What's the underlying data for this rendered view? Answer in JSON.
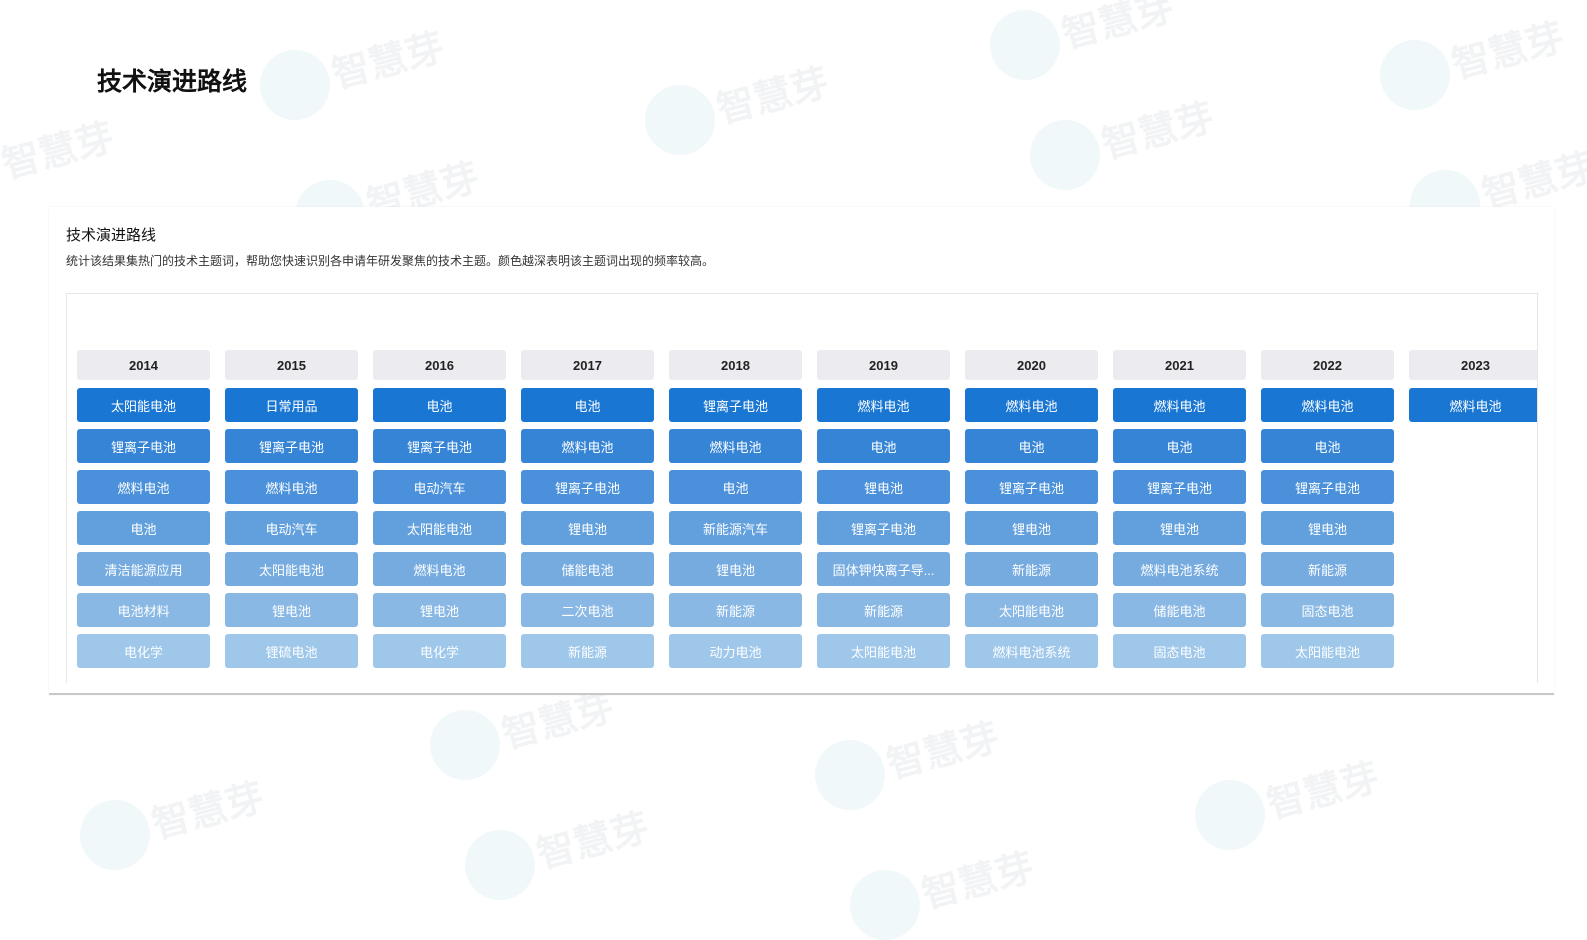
{
  "watermark": "智慧芽",
  "page_title": "技术演进路线",
  "card": {
    "title": "技术演进路线",
    "description": "统计该结果集热门的技术主题词，帮助您快速识别各申请年研发聚焦的技术主题。颜色越深表明该主题词出现的频率较高。"
  },
  "rank_colors": [
    "#1976d2",
    "#3584d6",
    "#4a90da",
    "#62a0dd",
    "#76abe0",
    "#8ab8e4",
    "#9ec7ea"
  ],
  "columns": [
    {
      "year": "2014",
      "keywords": [
        "太阳能电池",
        "锂离子电池",
        "燃料电池",
        "电池",
        "清洁能源应用",
        "电池材料",
        "电化学"
      ]
    },
    {
      "year": "2015",
      "keywords": [
        "日常用品",
        "锂离子电池",
        "燃料电池",
        "电动汽车",
        "太阳能电池",
        "锂电池",
        "锂硫电池"
      ]
    },
    {
      "year": "2016",
      "keywords": [
        "电池",
        "锂离子电池",
        "电动汽车",
        "太阳能电池",
        "燃料电池",
        "锂电池",
        "电化学"
      ]
    },
    {
      "year": "2017",
      "keywords": [
        "电池",
        "燃料电池",
        "锂离子电池",
        "锂电池",
        "储能电池",
        "二次电池",
        "新能源"
      ]
    },
    {
      "year": "2018",
      "keywords": [
        "锂离子电池",
        "燃料电池",
        "电池",
        "新能源汽车",
        "锂电池",
        "新能源",
        "动力电池"
      ]
    },
    {
      "year": "2019",
      "keywords": [
        "燃料电池",
        "电池",
        "锂电池",
        "锂离子电池",
        "固体钾快离子导...",
        "新能源",
        "太阳能电池"
      ]
    },
    {
      "year": "2020",
      "keywords": [
        "燃料电池",
        "电池",
        "锂离子电池",
        "锂电池",
        "新能源",
        "太阳能电池",
        "燃料电池系统"
      ]
    },
    {
      "year": "2021",
      "keywords": [
        "燃料电池",
        "电池",
        "锂离子电池",
        "锂电池",
        "燃料电池系统",
        "储能电池",
        "固态电池"
      ]
    },
    {
      "year": "2022",
      "keywords": [
        "燃料电池",
        "电池",
        "锂离子电池",
        "锂电池",
        "新能源",
        "固态电池",
        "太阳能电池"
      ]
    },
    {
      "year": "2023",
      "keywords": [
        "燃料电池"
      ]
    }
  ]
}
